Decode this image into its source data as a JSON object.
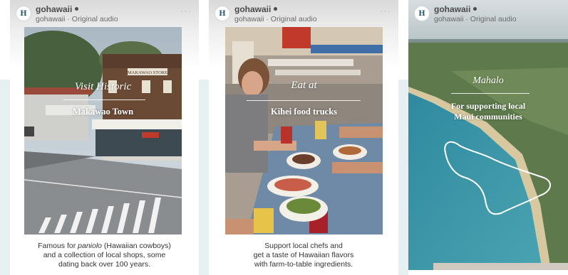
{
  "posts": [
    {
      "username": "gohawaii",
      "subline": "gohawaii · Original audio",
      "overlay_line1": "Visit Historic",
      "overlay_line2": "Makawao Town",
      "sign_text": "MAKAWAO STORE",
      "caption_line1_a": "Famous for ",
      "caption_line1_em": "paniolo",
      "caption_line1_b": " (Hawaiian cowboys)",
      "caption_line2": "and a collection of local shops, some",
      "caption_line3": "dating back over 100 years."
    },
    {
      "username": "gohawaii",
      "subline": "gohawaii · Original audio",
      "overlay_line1": "Eat at",
      "overlay_line2": "Kihei food trucks",
      "caption_line1": "Support local chefs and",
      "caption_line2": "get a taste of Hawaiian flavors",
      "caption_line3": "with farm-to-table ingredients."
    },
    {
      "username": "gohawaii",
      "subline": "gohawaii · Original audio",
      "overlay_line1": "Mahalo",
      "overlay_line2": "For supporting local",
      "overlay_line3": "Maui communities"
    }
  ],
  "avatar_glyph": "H",
  "more_glyph": "···",
  "icons": [
    "gohawaii-logo-icon",
    "verified-badge-icon",
    "more-options-icon"
  ],
  "colors": {
    "ocean": "#3e93a6",
    "shore": "#d8c8a0",
    "land": "#5d7a4a",
    "accent": "#c0392b",
    "caption_text": "#333333"
  }
}
